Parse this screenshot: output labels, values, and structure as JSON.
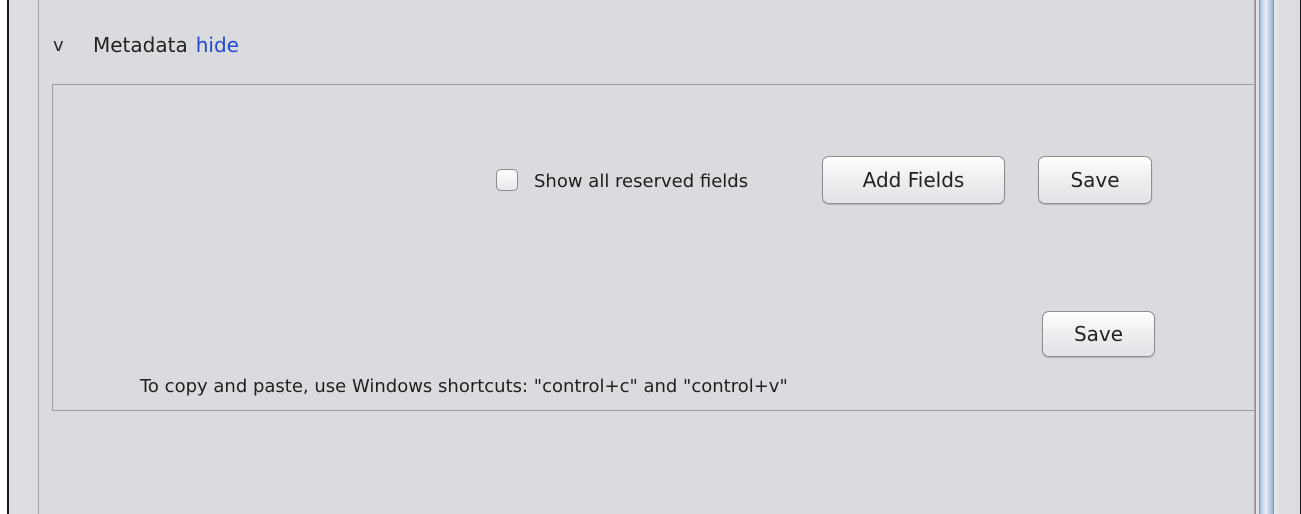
{
  "section": {
    "toggle": "v",
    "title": "Metadata",
    "hide_link": "hide"
  },
  "toolbar": {
    "show_reserved_label": "Show all reserved fields",
    "show_reserved_checked": false,
    "add_fields_label": "Add Fields",
    "save_label": "Save"
  },
  "footer": {
    "save_label": "Save",
    "hint": "To copy and paste, use Windows shortcuts: \"control+c\" and \"control+v\""
  },
  "colors": {
    "link": "#2349d4",
    "panel_background": "#dadbde",
    "scrollbar_thumb": "#a9c2de"
  }
}
